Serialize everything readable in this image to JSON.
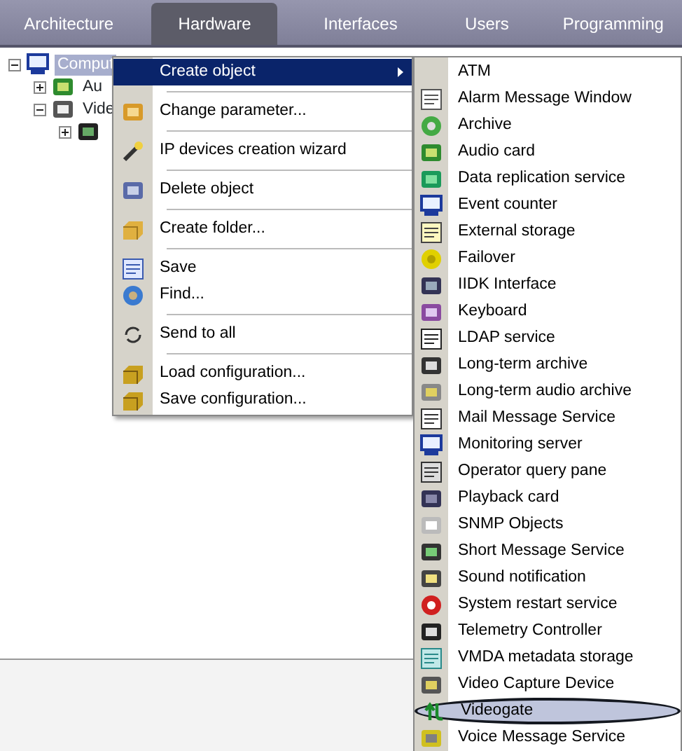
{
  "tabs": [
    {
      "label": "Architecture",
      "selected": false
    },
    {
      "label": "Hardware",
      "selected": true
    },
    {
      "label": "Interfaces",
      "selected": false
    },
    {
      "label": "Users",
      "selected": false
    },
    {
      "label": "Programming",
      "selected": false
    }
  ],
  "tree": [
    {
      "label": "Comput",
      "selected": true,
      "expanded": true,
      "children": [
        {
          "label": "Au",
          "selected": false,
          "expanded": false
        },
        {
          "label": "Vide",
          "selected": false,
          "expanded": true,
          "children": [
            {
              "expanded": false
            }
          ]
        }
      ]
    }
  ],
  "context_menu": [
    {
      "kind": "item",
      "label": "Create object",
      "selected": true,
      "has_submenu": true
    },
    {
      "kind": "separator"
    },
    {
      "kind": "item",
      "label": "Change parameter...",
      "selected": false,
      "has_submenu": false
    },
    {
      "kind": "separator"
    },
    {
      "kind": "item",
      "label": "IP devices creation wizard",
      "selected": false,
      "has_submenu": false
    },
    {
      "kind": "separator"
    },
    {
      "kind": "item",
      "label": "Delete object",
      "selected": false,
      "has_submenu": false
    },
    {
      "kind": "separator"
    },
    {
      "kind": "item",
      "label": "Create folder...",
      "selected": false,
      "has_submenu": false
    },
    {
      "kind": "separator"
    },
    {
      "kind": "item",
      "label": "Save",
      "selected": false,
      "has_submenu": false
    },
    {
      "kind": "item",
      "label": "Find...",
      "selected": false,
      "has_submenu": false
    },
    {
      "kind": "separator"
    },
    {
      "kind": "item",
      "label": "Send to all",
      "selected": false,
      "has_submenu": false
    },
    {
      "kind": "separator"
    },
    {
      "kind": "item",
      "label": "Load configuration...",
      "selected": false,
      "has_submenu": false
    },
    {
      "kind": "item",
      "label": "Save configuration...",
      "selected": false,
      "has_submenu": false
    }
  ],
  "submenu": [
    {
      "label": "ATM",
      "selected": false,
      "circled": false
    },
    {
      "label": "Alarm Message Window",
      "selected": false,
      "circled": false
    },
    {
      "label": "Archive",
      "selected": false,
      "circled": false
    },
    {
      "label": "Audio card",
      "selected": false,
      "circled": false
    },
    {
      "label": "Data replication service",
      "selected": false,
      "circled": false
    },
    {
      "label": "Event counter",
      "selected": false,
      "circled": false
    },
    {
      "label": "External storage",
      "selected": false,
      "circled": false
    },
    {
      "label": "Failover",
      "selected": false,
      "circled": false
    },
    {
      "label": "IIDK Interface",
      "selected": false,
      "circled": false
    },
    {
      "label": "Keyboard",
      "selected": false,
      "circled": false
    },
    {
      "label": "LDAP service",
      "selected": false,
      "circled": false
    },
    {
      "label": "Long-term archive",
      "selected": false,
      "circled": false
    },
    {
      "label": "Long-term audio archive",
      "selected": false,
      "circled": false
    },
    {
      "label": "Mail Message Service",
      "selected": false,
      "circled": false
    },
    {
      "label": "Monitoring server",
      "selected": false,
      "circled": false
    },
    {
      "label": "Operator query pane",
      "selected": false,
      "circled": false
    },
    {
      "label": "Playback card",
      "selected": false,
      "circled": false
    },
    {
      "label": "SNMP Objects",
      "selected": false,
      "circled": false
    },
    {
      "label": "Short Message Service",
      "selected": false,
      "circled": false
    },
    {
      "label": "Sound notification",
      "selected": false,
      "circled": false
    },
    {
      "label": "System restart service",
      "selected": false,
      "circled": false
    },
    {
      "label": "Telemetry Controller",
      "selected": false,
      "circled": false
    },
    {
      "label": "VMDA metadata storage",
      "selected": false,
      "circled": false
    },
    {
      "label": "Video Capture Device",
      "selected": false,
      "circled": false
    },
    {
      "label": "Videogate",
      "selected": true,
      "circled": true
    },
    {
      "label": "Voice Message Service",
      "selected": false,
      "circled": false
    }
  ]
}
